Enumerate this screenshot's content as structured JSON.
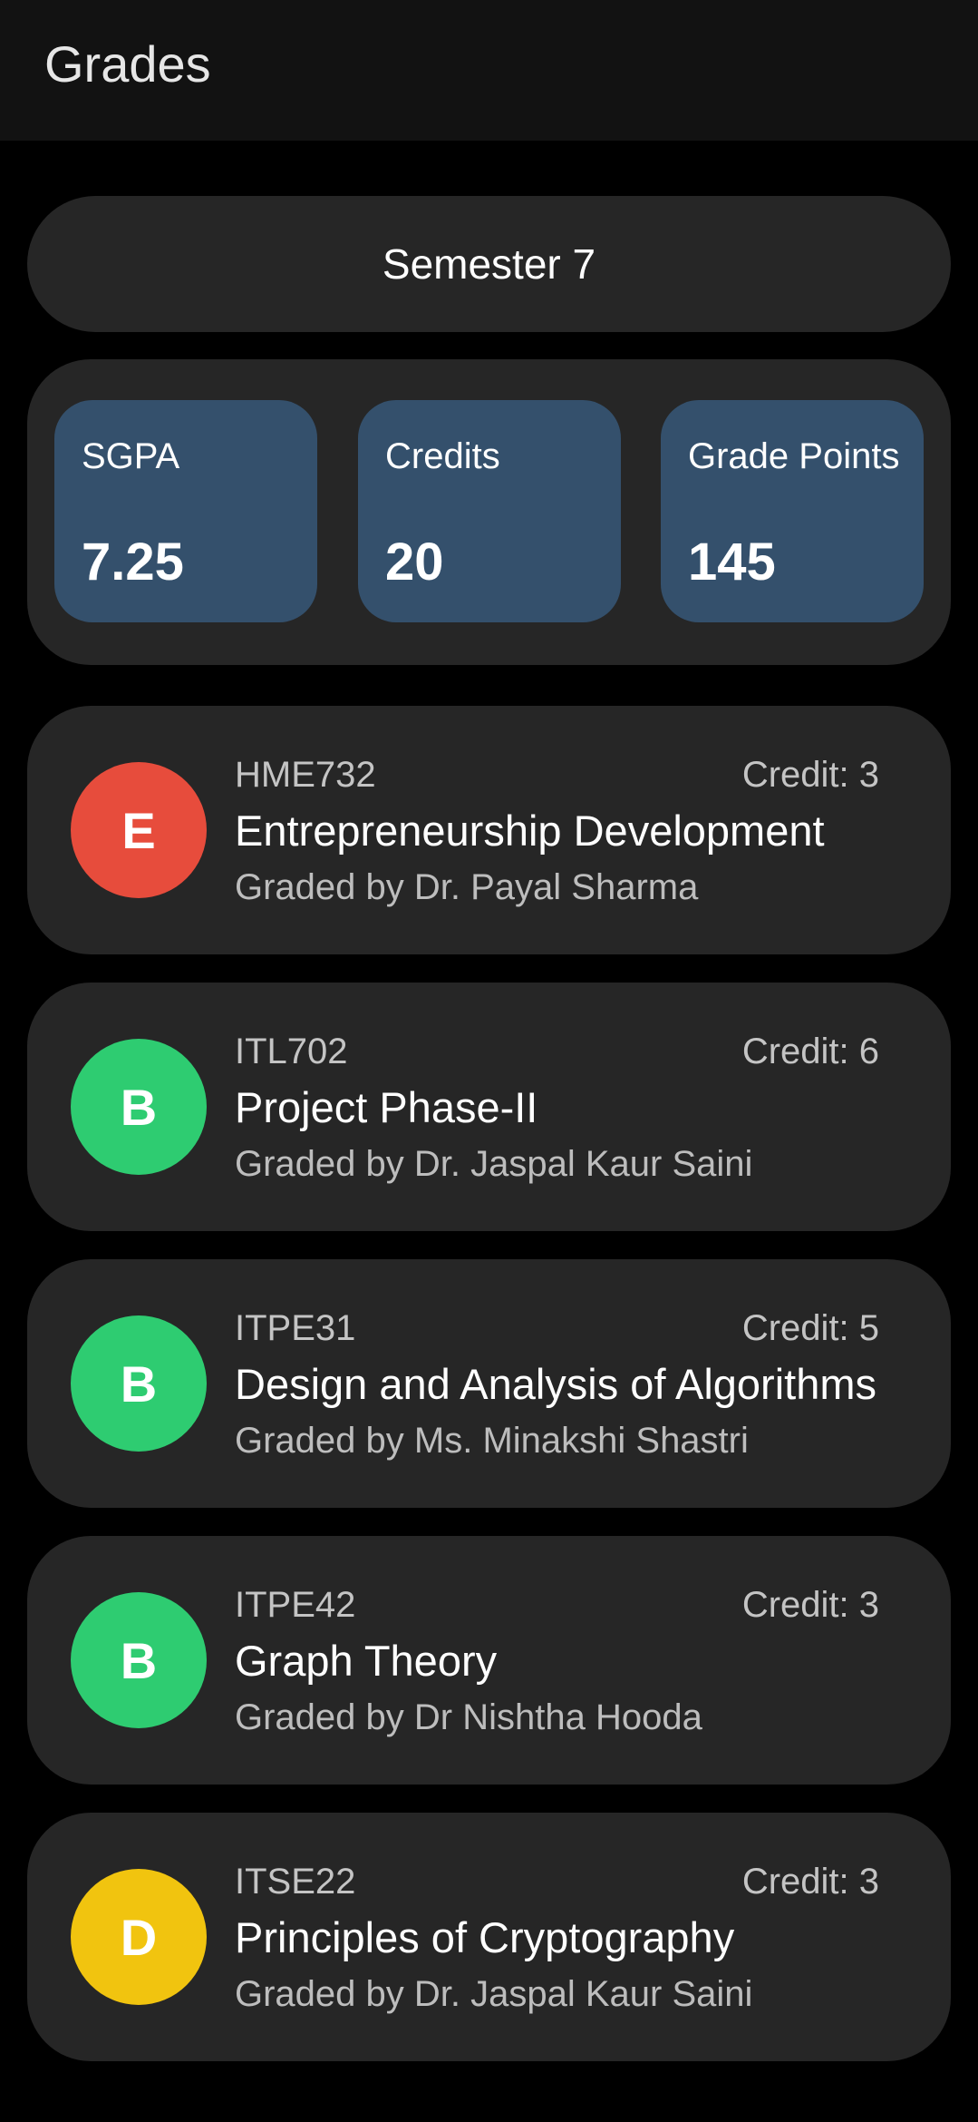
{
  "appbar": {
    "title": "Grades"
  },
  "semester": {
    "label": "Semester 7"
  },
  "summary": {
    "sgpa": {
      "label": "SGPA",
      "value": "7.25"
    },
    "credits": {
      "label": "Credits",
      "value": "20"
    },
    "grade_points": {
      "label": "Grade Points",
      "value": "145"
    }
  },
  "colors": {
    "grade_E": "#E74C3C",
    "grade_B": "#2ECC71",
    "grade_D": "#F1C40F",
    "stat_card": "#34506C",
    "card": "#262626"
  },
  "courses": [
    {
      "grade": "E",
      "code": "HME732",
      "credit": "Credit: 3",
      "name": "Entrepreneurship Development",
      "grader": "Graded by Dr. Payal Sharma"
    },
    {
      "grade": "B",
      "code": "ITL702",
      "credit": "Credit: 6",
      "name": "Project Phase-II",
      "grader": "Graded by Dr. Jaspal Kaur Saini"
    },
    {
      "grade": "B",
      "code": "ITPE31",
      "credit": "Credit: 5",
      "name": "Design and Analysis of Algorithms",
      "grader": "Graded by Ms. Minakshi Shastri"
    },
    {
      "grade": "B",
      "code": "ITPE42",
      "credit": "Credit: 3",
      "name": "Graph Theory",
      "grader": "Graded by Dr Nishtha Hooda"
    },
    {
      "grade": "D",
      "code": "ITSE22",
      "credit": "Credit: 3",
      "name": "Principles of Cryptography",
      "grader": "Graded by Dr. Jaspal Kaur Saini"
    }
  ]
}
